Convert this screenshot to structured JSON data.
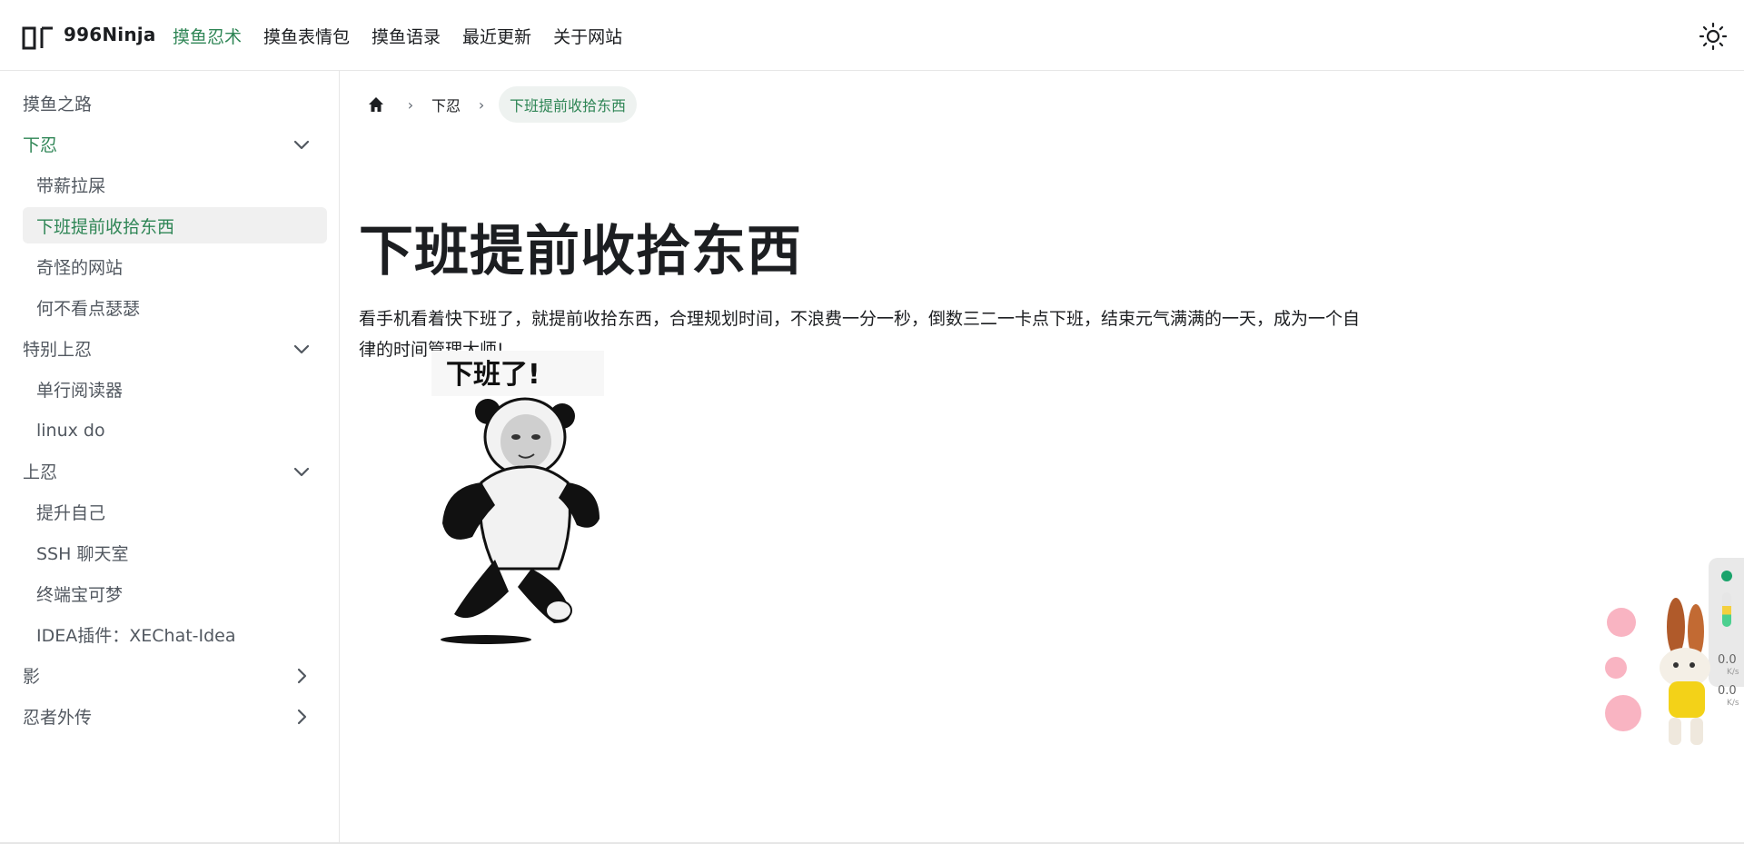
{
  "header": {
    "brand": "996Ninja",
    "nav": [
      {
        "label": "摸鱼忍术",
        "active": true
      },
      {
        "label": "摸鱼表情包",
        "active": false
      },
      {
        "label": "摸鱼语录",
        "active": false
      },
      {
        "label": "最近更新",
        "active": false
      },
      {
        "label": "关于网站",
        "active": false
      }
    ],
    "theme_icon": "sun-icon"
  },
  "sidebar": {
    "items": [
      {
        "label": "摸鱼之路",
        "level": 0
      },
      {
        "label": "下忍",
        "level": 0,
        "caret": "chevron-down-icon"
      },
      {
        "label": "带薪拉屎",
        "level": 1
      },
      {
        "label": "下班提前收拾东西",
        "level": 1
      },
      {
        "label": "奇怪的网站",
        "level": 1
      },
      {
        "label": "何不看点瑟瑟",
        "level": 1
      },
      {
        "label": "特别上忍",
        "level": 0,
        "caret": "chevron-down-icon"
      },
      {
        "label": "单行阅读器",
        "level": 1
      },
      {
        "label": "linux do",
        "level": 1
      },
      {
        "label": "上忍",
        "level": 0,
        "caret": "chevron-down-icon"
      },
      {
        "label": "提升自己",
        "level": 1
      },
      {
        "label": "SSH 聊天室",
        "level": 1
      },
      {
        "label": "终端宝可梦",
        "level": 1
      },
      {
        "label": "IDEA插件：XEChat-Idea",
        "level": 1
      },
      {
        "label": "影",
        "level": 0,
        "caret": "chevron-right-icon"
      },
      {
        "label": "忍者外传",
        "level": 0,
        "caret": "chevron-right-icon"
      }
    ]
  },
  "breadcrumb": {
    "home_icon": "home-icon",
    "items": [
      "下忍",
      "下班提前收拾东西"
    ]
  },
  "main": {
    "title": "下班提前收拾东西",
    "paragraph": "看手机看着快下班了，就提前收拾东西，合理规划时间，不浪费一分一秒，倒数三二一卡点下班，结束元气满满的一天，成为一个自律的时间管理大师!",
    "meme_caption": "下班了!"
  },
  "widgets": {
    "net_speed_up": "0.0",
    "net_speed_down": "0.0",
    "unit": "K/s"
  },
  "colors": {
    "accent": "#2e8555",
    "text": "#1c1e21",
    "muted": "#525860",
    "active_bg": "#f0f0f0",
    "border": "#e6e6e6"
  }
}
